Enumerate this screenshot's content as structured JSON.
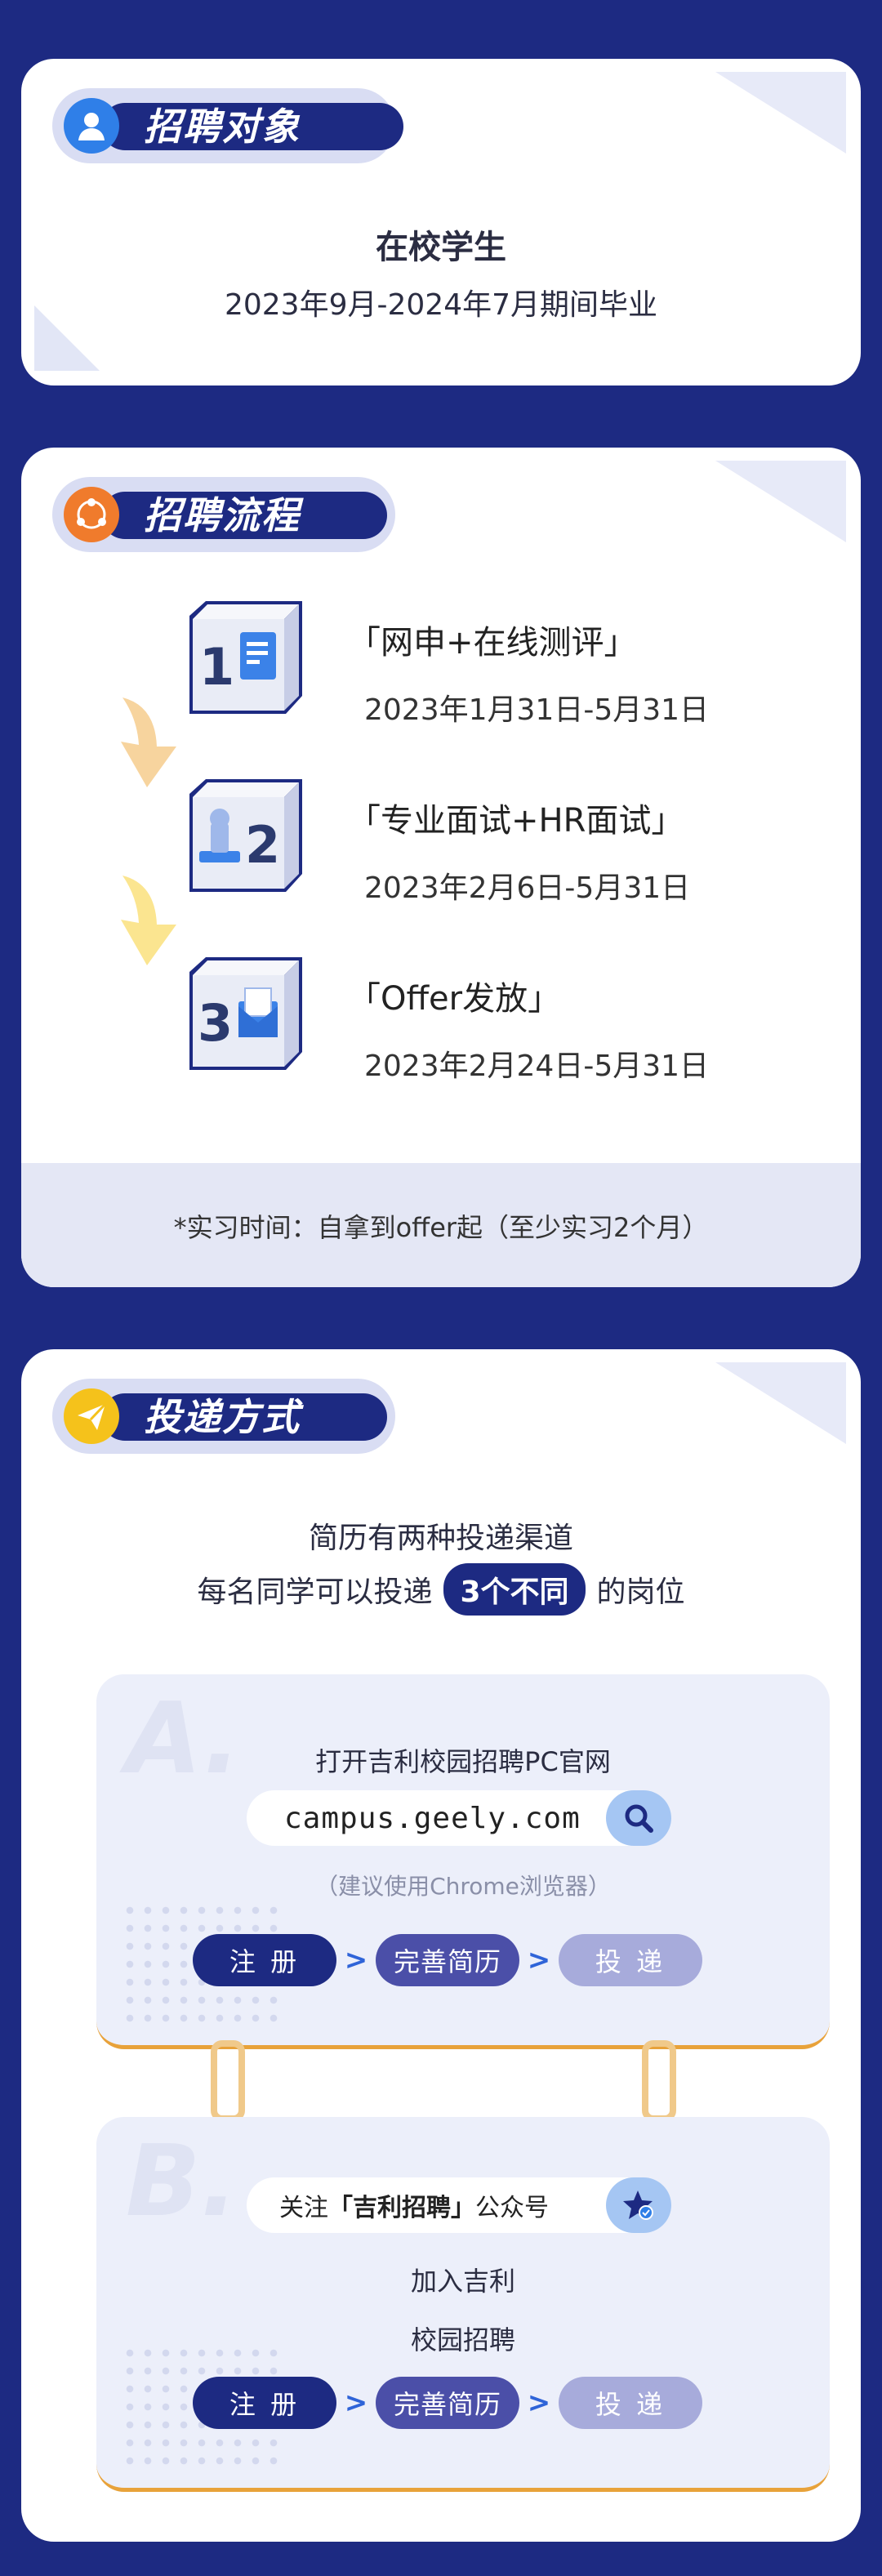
{
  "section1": {
    "heading": "招聘对象",
    "line1": "在校学生",
    "line2": "2023年9月-2024年7月期间毕业"
  },
  "section2": {
    "heading": "招聘流程",
    "steps": [
      {
        "number": "1",
        "title": "「网申+在线测评」",
        "date": "2023年1月31日-5月31日"
      },
      {
        "number": "2",
        "title": "「专业面试+HR面试」",
        "date": "2023年2月6日-5月31日"
      },
      {
        "number": "3",
        "title": "「Offer发放」",
        "date": "2023年2月24日-5月31日"
      }
    ],
    "footnote": "*实习时间：自拿到offer起（至少实习2个月）"
  },
  "section3": {
    "heading": "投递方式",
    "line1": "简历有两种投递渠道",
    "line2_pre": "每名同学可以投递",
    "line2_badge": "3个不同",
    "line2_post": "的岗位",
    "channelA": {
      "letter": "A.",
      "title": "打开吉利校园招聘PC官网",
      "url": "campus.geely.com",
      "note": "（建议使用Chrome浏览器）",
      "steps": [
        "注 册",
        "完善简历",
        "投 递"
      ]
    },
    "channelB": {
      "letter": "B.",
      "follow_pre": "关注",
      "follow_name": "「吉利招聘」",
      "follow_post": "公众号",
      "line1": "加入吉利",
      "line2": "校园招聘",
      "steps": [
        "注 册",
        "完善简历",
        "投 递"
      ]
    }
  },
  "colors": {
    "background": "#1d2a82",
    "step1": "#1d2a82",
    "step2": "#4b4fa8",
    "step3": "#a7abdb",
    "accent_orange": "#e8a23a"
  }
}
